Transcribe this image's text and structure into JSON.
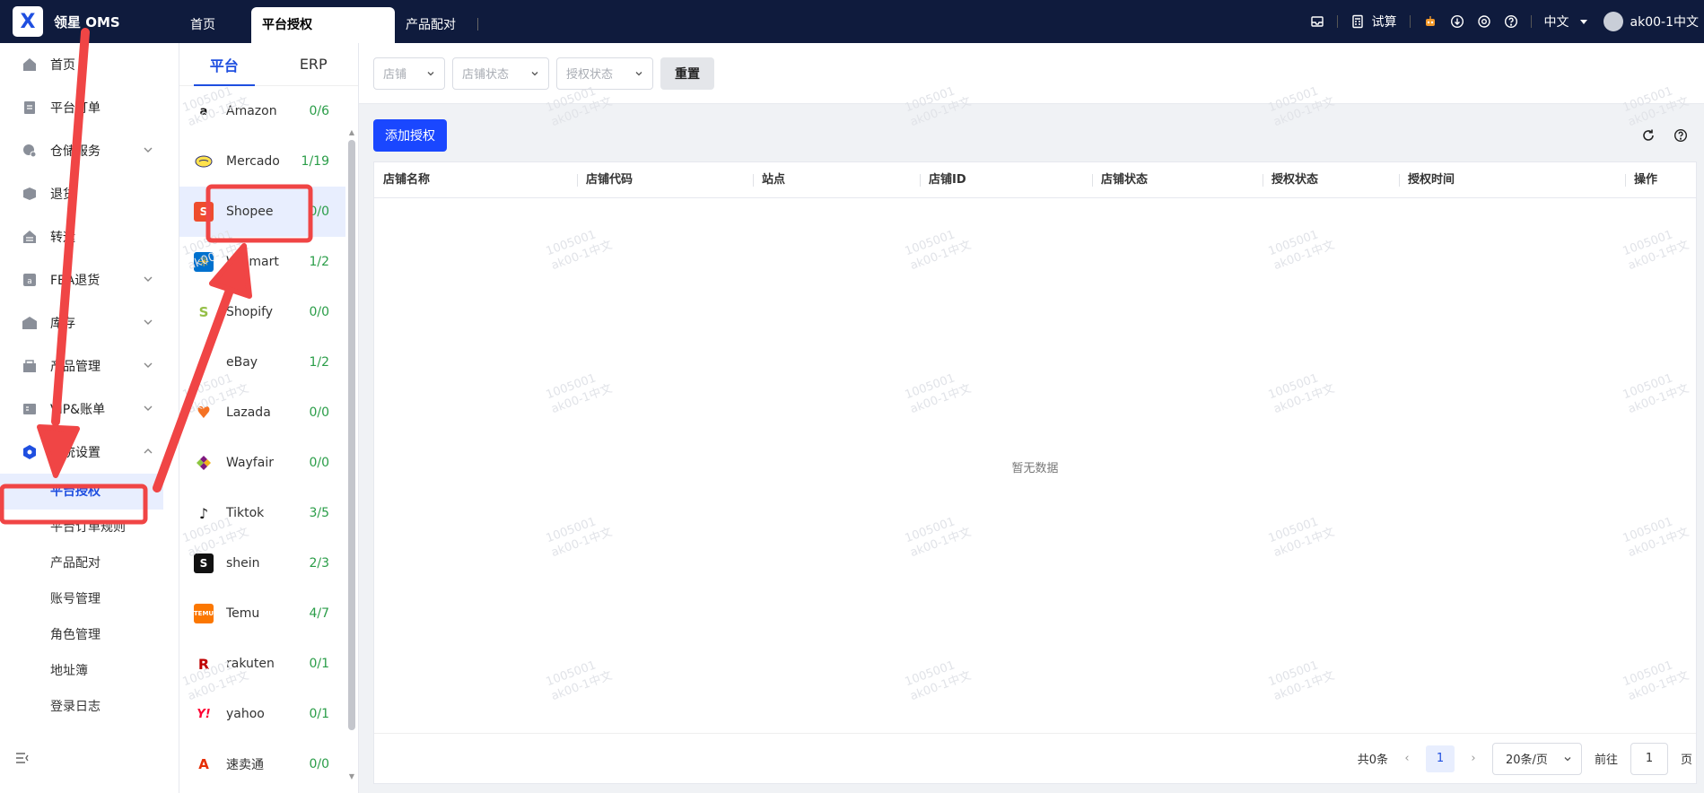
{
  "app": {
    "title": "领星 OMS"
  },
  "top_tabs": [
    {
      "label": "首页"
    },
    {
      "label": "平台授权"
    },
    {
      "label": "产品配对"
    }
  ],
  "top_right": {
    "calc_label": "试算",
    "lang_label": "中文",
    "user_label": "ak00-1中文"
  },
  "sidebar": {
    "items": [
      {
        "label": "首页"
      },
      {
        "label": "平台订单"
      },
      {
        "label": "仓储服务"
      },
      {
        "label": "退货"
      },
      {
        "label": "转运"
      },
      {
        "label": "FBA退货"
      },
      {
        "label": "库存"
      },
      {
        "label": "产品管理"
      },
      {
        "label": "VIP&账单"
      },
      {
        "label": "系统设置"
      }
    ],
    "subitems": [
      {
        "label": "平台授权"
      },
      {
        "label": "平台订单规则"
      },
      {
        "label": "产品配对"
      },
      {
        "label": "账号管理"
      },
      {
        "label": "角色管理"
      },
      {
        "label": "地址簿"
      },
      {
        "label": "登录日志"
      }
    ]
  },
  "platform_panel": {
    "tabs": [
      {
        "label": "平台"
      },
      {
        "label": "ERP"
      }
    ],
    "platforms": [
      {
        "name": "Amazon",
        "count": "0/6"
      },
      {
        "name": "Mercado",
        "count": "1/19"
      },
      {
        "name": "Shopee",
        "count": "0/0"
      },
      {
        "name": "Walmart",
        "count": "1/2"
      },
      {
        "name": "Shopify",
        "count": "0/0"
      },
      {
        "name": "eBay",
        "count": "1/2"
      },
      {
        "name": "Lazada",
        "count": "0/0"
      },
      {
        "name": "Wayfair",
        "count": "0/0"
      },
      {
        "name": "Tiktok",
        "count": "3/5"
      },
      {
        "name": "shein",
        "count": "2/3"
      },
      {
        "name": "Temu",
        "count": "4/7"
      },
      {
        "name": "rakuten",
        "count": "0/1"
      },
      {
        "name": "yahoo",
        "count": "0/1"
      },
      {
        "name": "速卖通",
        "count": "0/0"
      }
    ]
  },
  "filters": {
    "store_placeholder": "店铺",
    "store_status_placeholder": "店铺状态",
    "auth_status_placeholder": "授权状态",
    "reset_label": "重置"
  },
  "actions": {
    "add_label": "添加授权"
  },
  "table": {
    "columns": [
      "店铺名称",
      "店铺代码",
      "站点",
      "店铺ID",
      "店铺状态",
      "授权状态",
      "授权时间",
      "操作"
    ],
    "empty_text": "暂无数据"
  },
  "pagination": {
    "total_label": "共0条",
    "current_page": "1",
    "page_size": "20条/页",
    "goto_prefix": "前往",
    "goto_value": "1",
    "goto_suffix": "页"
  },
  "watermark": {
    "line1": "1005001",
    "line2": "ak00-1中文"
  },
  "colors": {
    "topbar": "#0f1b3d",
    "accent": "#1f4fe0",
    "annotation": "#f04545",
    "count_green": "#2a9d48"
  }
}
